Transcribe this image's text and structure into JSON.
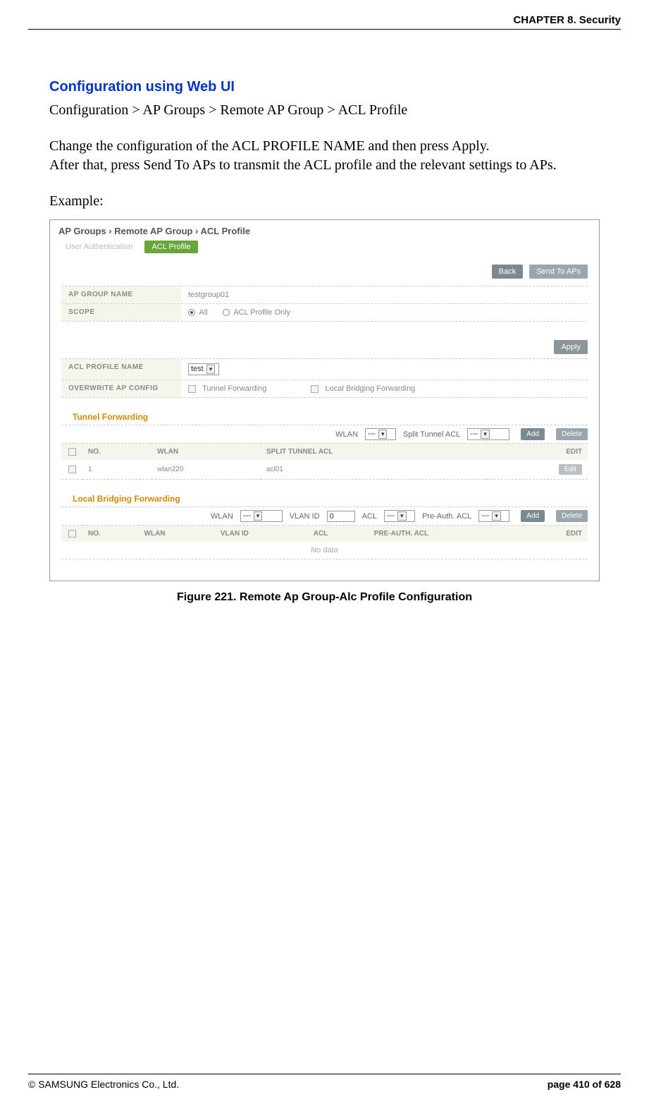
{
  "header": {
    "chapter": "CHAPTER 8. Security"
  },
  "doc": {
    "section_title": "Configuration using Web UI",
    "breadcrumb": "Configuration > AP Groups > Remote AP Group > ACL Profile",
    "para1": "Change the configuration of the ACL PROFILE NAME and then press Apply.",
    "para2": "After that, press Send To APs to transmit the ACL profile and the relevant settings to APs.",
    "example_label": "Example:",
    "figure_caption": "Figure 221. Remote Ap Group-Alc Profile Configuration"
  },
  "screenshot": {
    "crumbs": "AP Groups  ›  Remote AP Group  ›  ACL Profile",
    "tabs": {
      "inactive": "User Authentication",
      "active": "ACL Profile"
    },
    "buttons": {
      "back": "Back",
      "send": "Send To APs",
      "apply": "Apply",
      "add": "Add",
      "delete": "Delete",
      "edit": "Edit"
    },
    "form": {
      "group_name_label": "AP GROUP NAME",
      "group_name_value": "testgroup01",
      "scope_label": "SCOPE",
      "scope_all": "All",
      "scope_acl": "ACL Profile Only",
      "acl_profile_label": "ACL PROFILE NAME",
      "acl_profile_value": "test",
      "overwrite_label": "OVERWRITE AP CONFIG",
      "tunnel_cb": "Tunnel Forwarding",
      "local_cb": "Local Bridging Forwarding"
    },
    "tunnel": {
      "heading": "Tunnel Forwarding",
      "wlan_label": "WLAN",
      "split_label": "Split Tunnel ACL",
      "sel_blank": "---",
      "cols": {
        "no": "NO.",
        "wlan": "WLAN",
        "split": "SPLIT TUNNEL ACL",
        "edit": "EDIT"
      },
      "row": {
        "no": "1",
        "wlan": "wlan220",
        "acl": "acl01"
      }
    },
    "local": {
      "heading": "Local Bridging Forwarding",
      "wlan_label": "WLAN",
      "vlan_label": "VLAN ID",
      "vlan_value": "0",
      "acl_label": "ACL",
      "preauth_label": "Pre-Auth. ACL",
      "sel_blank": "---",
      "cols": {
        "no": "NO.",
        "wlan": "WLAN",
        "vlan": "VLAN ID",
        "acl": "ACL",
        "preauth": "PRE-AUTH. ACL",
        "edit": "EDIT"
      },
      "nodata": "No data"
    }
  },
  "footer": {
    "copyright": "© SAMSUNG Electronics Co., Ltd.",
    "page": "page 410 of 628"
  }
}
